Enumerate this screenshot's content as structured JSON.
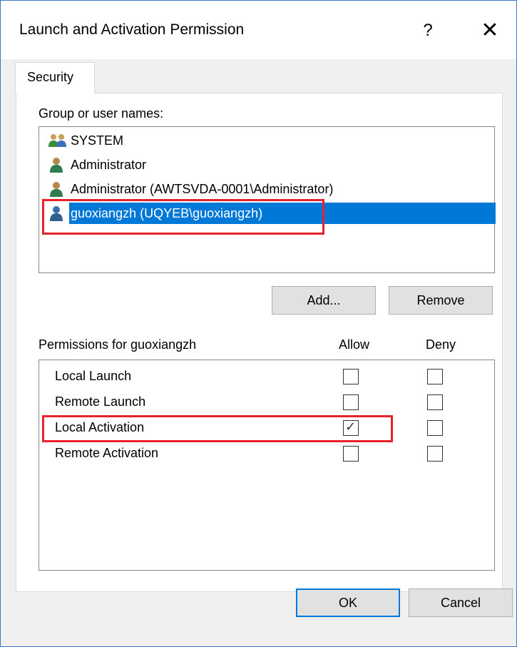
{
  "window": {
    "title": "Launch and Activation Permission",
    "help_glyph": "?",
    "close_glyph": "✕"
  },
  "tabs": [
    {
      "label": "Security",
      "selected": true
    }
  ],
  "group_list": {
    "label": "Group or user names:",
    "items": [
      {
        "label": "SYSTEM",
        "icon": "users-group-icon",
        "selected": false
      },
      {
        "label": "Administrator",
        "icon": "user-icon",
        "selected": false
      },
      {
        "label": "Administrator (AWTSVDA-0001\\Administrator)",
        "icon": "user-icon",
        "selected": false
      },
      {
        "label": "guoxiangzh (UQYEB\\guoxiangzh)",
        "icon": "user-icon",
        "selected": true
      }
    ]
  },
  "buttons": {
    "add": "Add...",
    "remove": "Remove",
    "ok": "OK",
    "cancel": "Cancel"
  },
  "permissions": {
    "header": "Permissions for guoxiangzh",
    "allow_header": "Allow",
    "deny_header": "Deny",
    "rows": [
      {
        "name": "Local Launch",
        "allow": false,
        "deny": false
      },
      {
        "name": "Remote Launch",
        "allow": false,
        "deny": false
      },
      {
        "name": "Local Activation",
        "allow": true,
        "deny": false
      },
      {
        "name": "Remote Activation",
        "allow": false,
        "deny": false
      }
    ]
  },
  "colors": {
    "selection": "#0078d7",
    "highlight_annotation": "#e8222c",
    "window_border": "#3c78c8"
  }
}
